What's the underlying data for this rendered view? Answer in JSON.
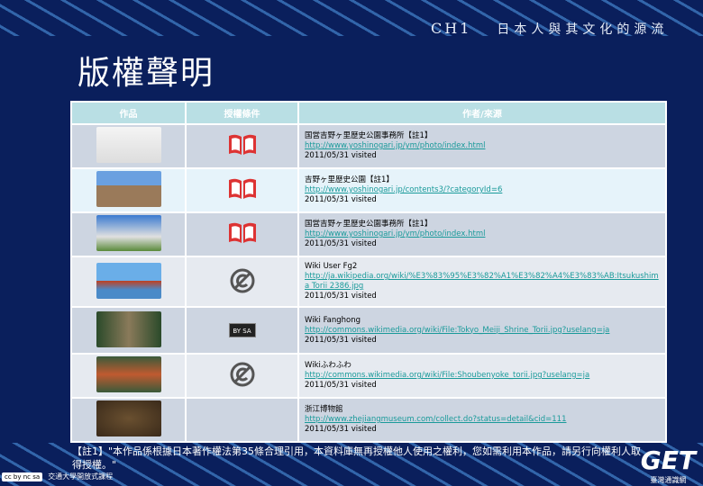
{
  "header": {
    "chapter": "CH1",
    "chapter_title": "日本人與其文化的源流"
  },
  "page_title": "版權聲明",
  "table": {
    "columns": [
      "作品",
      "授權條件",
      "作者/來源"
    ],
    "rows": [
      {
        "license": "fair-use-book-icon",
        "author": "国営吉野ヶ里歴史公園事務所【註1】",
        "url": "http://www.yoshinogari.jp/ym/photo/index.html",
        "extra": "",
        "visited": "2011/05/31 visited"
      },
      {
        "license": "fair-use-book-icon",
        "author": "吉野ヶ里歴史公園【註1】",
        "url": "http://www.yoshinogari.jp/contents3/?categoryId=6",
        "extra": "",
        "visited": "2011/05/31 visited"
      },
      {
        "license": "fair-use-book-icon",
        "author": "国営吉野ヶ里歴史公園事務所【註1】",
        "url": "http://www.yoshinogari.jp/ym/photo/index.html",
        "extra": "",
        "visited": "2011/05/31 visited"
      },
      {
        "license": "no-copyright-icon",
        "author": "Wiki User Fg2",
        "url": "http://ja.wikipedia.org/wiki/%E3%83%95%E3%82%A1%E3%82%A4%E3%83%AB:Itsukushima Torii 2386.jpg",
        "extra": "",
        "visited": "2011/05/31 visited"
      },
      {
        "license": "cc-by-sa-icon",
        "author": "Wiki Fanghong",
        "url": "http://commons.wikimedia.org/wiki/File:Tokyo_Meiji_Shrine_Torii.jpg?uselang=ja",
        "extra": "",
        "visited": "2011/05/31 visited"
      },
      {
        "license": "no-copyright-icon",
        "author": "Wikiふわふわ",
        "url": "http://commons.wikimedia.org/wiki/File:Shoubenyoke_torii.jpg?uselang=ja",
        "extra": "",
        "visited": "2011/05/31 visited"
      },
      {
        "license": "none",
        "author": "浙江博物館",
        "url": "http://www.zhejiangmuseum.com/collect.do?status=detail&cid=111",
        "extra": "",
        "visited": "2011/05/31 visited"
      }
    ]
  },
  "cc_label": "BY SA",
  "note": "【註1】\"本作品係根據日本著作權法第35條合理引用，本資料庫無再授權他人使用之權利，您如需利用本作品，請另行向權利人取得授權。\"",
  "footer": {
    "cc": "cc by nc sa",
    "org": "交通大學開放式課程",
    "logo": "GET",
    "logo_sub": "臺灣通識網"
  }
}
